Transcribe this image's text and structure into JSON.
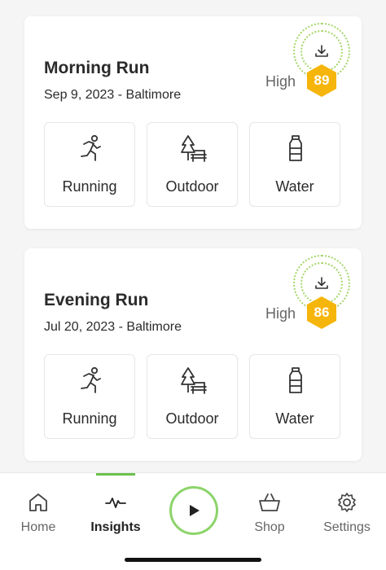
{
  "activities": [
    {
      "title": "Morning Run",
      "date_location": "Sep 9, 2023 - Baltimore",
      "level": "High",
      "score": "89",
      "tags": [
        {
          "label": "Running",
          "icon": "running-icon"
        },
        {
          "label": "Outdoor",
          "icon": "outdoor-tree-bench-icon"
        },
        {
          "label": "Water",
          "icon": "water-bottle-icon"
        }
      ]
    },
    {
      "title": "Evening Run",
      "date_location": "Jul 20, 2023 - Baltimore",
      "level": "High",
      "score": "86",
      "tags": [
        {
          "label": "Running",
          "icon": "running-icon"
        },
        {
          "label": "Outdoor",
          "icon": "outdoor-tree-bench-icon"
        },
        {
          "label": "Water",
          "icon": "water-bottle-icon"
        }
      ]
    }
  ],
  "nav": {
    "items": [
      {
        "label": "Home",
        "icon": "home-icon"
      },
      {
        "label": "Insights",
        "icon": "activity-wave-icon",
        "active": true
      },
      {
        "label": "Play",
        "icon": "play-icon"
      },
      {
        "label": "Shop",
        "icon": "basket-icon"
      },
      {
        "label": "Settings",
        "icon": "gear-icon"
      }
    ]
  },
  "colors": {
    "accent_green": "#6cc04a",
    "score_badge": "#f5b50a",
    "background": "#f5f5f5"
  }
}
